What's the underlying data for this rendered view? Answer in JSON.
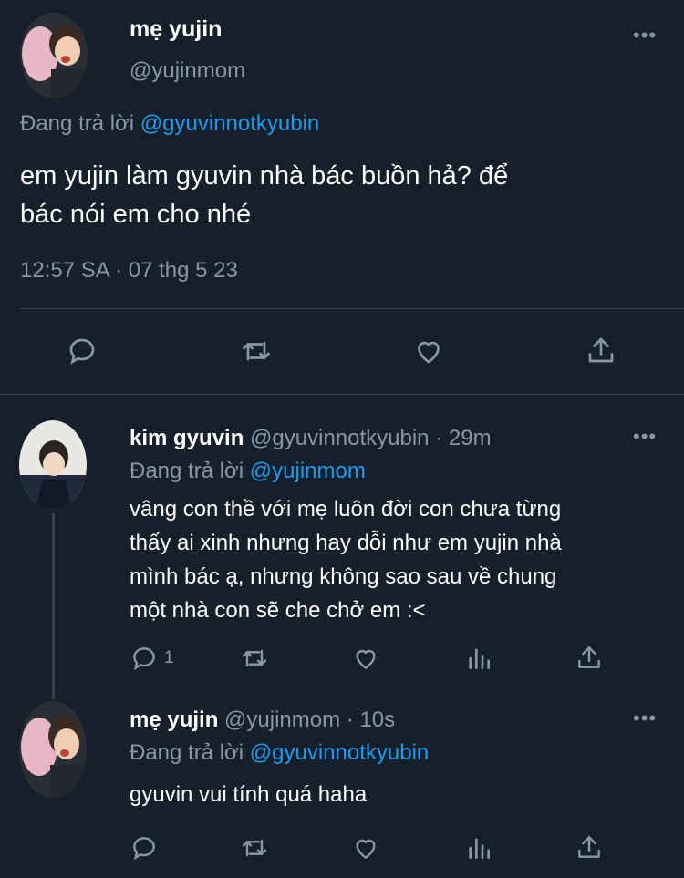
{
  "main_tweet": {
    "display_name": "mẹ yujin",
    "handle": "@yujinmom",
    "replying_prefix": "Đang trả lời",
    "replying_to": "@gyuvinnotkyubin",
    "text_line1": "em yujin làm gyuvin nhà bác buồn hả? để",
    "text_line2": "bác nói em cho nhé",
    "time": "12:57 SA",
    "separator": "·",
    "date": "07 thg 5 23",
    "more_label": "•••"
  },
  "replies": [
    {
      "display_name": "kim gyuvin",
      "handle": "@gyuvinnotkyubin",
      "separator": "·",
      "age": "29m",
      "replying_prefix": "Đang trả lời",
      "replying_to": "@yujinmom",
      "text_line1": "vâng con thề với mẹ luôn đời con chưa từng",
      "text_line2": "thấy ai xinh nhưng hay dỗi như em yujin nhà",
      "text_line3": "mình bác ạ, nhưng không sao sau về chung",
      "text_line4": "một nhà con sẽ che chở em :<",
      "reply_count": "1",
      "more_label": "•••"
    },
    {
      "display_name": "mẹ yujin",
      "handle": "@yujinmom",
      "separator": "·",
      "age": "10s",
      "replying_prefix": "Đang trả lời",
      "replying_to": "@gyuvinnotkyubin",
      "text_line1": "gyuvin vui tính quá haha",
      "more_label": "•••"
    }
  ],
  "colors": {
    "background": "#15202b",
    "muted": "#8899a6",
    "link": "#1d9bf0",
    "divider": "#38444d"
  },
  "icons": [
    "reply-icon",
    "retweet-icon",
    "like-icon",
    "share-icon",
    "analytics-icon",
    "more-icon"
  ]
}
